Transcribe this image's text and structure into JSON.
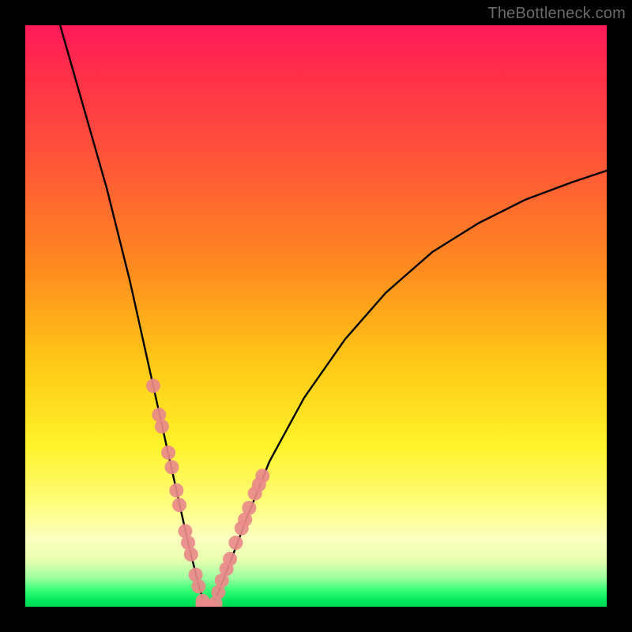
{
  "watermark": "TheBottleneck.com",
  "chart_data": {
    "type": "line",
    "title": "",
    "xlabel": "",
    "ylabel": "",
    "xlim": [
      0,
      100
    ],
    "ylim": [
      0,
      100
    ],
    "grid": false,
    "legend": false,
    "annotations": [],
    "series": [
      {
        "name": "bottleneck-curve",
        "color": "#000000",
        "x": [
          6,
          10,
          14,
          18,
          22,
          24,
          26,
          28,
          29,
          30,
          31,
          32,
          33,
          35,
          38,
          42,
          48,
          55,
          62,
          70,
          78,
          86,
          94,
          100
        ],
        "y": [
          100,
          86,
          72,
          56,
          38,
          29,
          20,
          11,
          7,
          3,
          0,
          0,
          2,
          7,
          15,
          25,
          36,
          46,
          54,
          61,
          66,
          70,
          73,
          75
        ]
      }
    ],
    "markers": [
      {
        "name": "left-cluster",
        "color": "#e98a8a",
        "radius_px": 9,
        "x": [
          22.0,
          23.0,
          23.5,
          24.6,
          25.2,
          26.0,
          26.5,
          27.5,
          28.0,
          28.5,
          29.3,
          29.8,
          30.5
        ],
        "y": [
          38.0,
          33.0,
          31.0,
          26.5,
          24.0,
          20.0,
          17.5,
          13.0,
          11.0,
          9.0,
          5.5,
          3.5,
          1.0
        ]
      },
      {
        "name": "right-cluster",
        "color": "#e98a8a",
        "radius_px": 9,
        "x": [
          33.2,
          33.8,
          34.6,
          35.2,
          36.2,
          37.2,
          37.8,
          38.5,
          39.5,
          40.2,
          40.8
        ],
        "y": [
          2.5,
          4.5,
          6.5,
          8.2,
          11.0,
          13.5,
          15.0,
          17.0,
          19.5,
          21.0,
          22.5
        ]
      },
      {
        "name": "bottom-cluster",
        "color": "#e98a8a",
        "radius_px": 9,
        "x": [
          30.5,
          31.3,
          32.0,
          32.7
        ],
        "y": [
          0.3,
          0.0,
          0.0,
          0.6
        ]
      }
    ]
  }
}
